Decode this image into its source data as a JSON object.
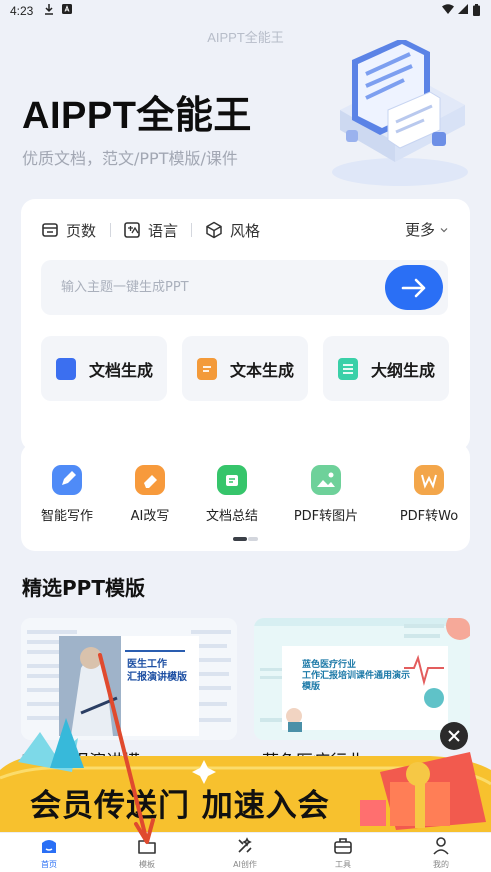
{
  "status_bar": {
    "time": "4:23"
  },
  "header": {
    "title": "AIPPT全能王"
  },
  "hero": {
    "title": "AIPPT全能王",
    "subtitle": "优质文档，范文/PPT模版/课件"
  },
  "options": [
    {
      "label": "页数",
      "icon": "page-count-icon"
    },
    {
      "label": "语言",
      "icon": "language-icon"
    },
    {
      "label": "风格",
      "icon": "style-cube-icon"
    }
  ],
  "more_label": "更多",
  "search": {
    "placeholder": "输入主题一键生成PPT",
    "value": ""
  },
  "generate_buttons": [
    {
      "label": "文档生成",
      "color": "#3b6ff0"
    },
    {
      "label": "文本生成",
      "color": "#f39a3a"
    },
    {
      "label": "大纲生成",
      "color": "#3ad0a8"
    }
  ],
  "tools": [
    {
      "label": "智能写作",
      "color": "#4f8bf7"
    },
    {
      "label": "AI改写",
      "color": "#f79a3c"
    },
    {
      "label": "文档总结",
      "color": "#36c56b"
    },
    {
      "label": "PDF转图片",
      "color": "#6ed19a"
    },
    {
      "label": "PDF转Wo",
      "color": "#f3a64a"
    }
  ],
  "section": {
    "title": "精选PPT模版"
  },
  "templates": [
    {
      "name": "工作汇报演讲模",
      "thumb_title_line1": "医生工作",
      "thumb_title_line2": "汇报演讲模版"
    },
    {
      "name": "蓝色医疗行业",
      "thumb_title_line1": "蓝色医疗行业",
      "thumb_title_line2": "工作汇报培训课件通用演示",
      "thumb_title_line3": "模版"
    }
  ],
  "banner": {
    "text": "会员传送门 加速入会"
  },
  "tabbar": [
    {
      "label": "首页",
      "active": true
    },
    {
      "label": "模板",
      "active": false
    },
    {
      "label": "AI创作",
      "active": false
    },
    {
      "label": "工具",
      "active": false
    },
    {
      "label": "我的",
      "active": false
    }
  ],
  "colors": {
    "accent": "#2a6ff5",
    "page_bg": "#eef1f8",
    "annotation_arrow": "#e04a2e"
  }
}
